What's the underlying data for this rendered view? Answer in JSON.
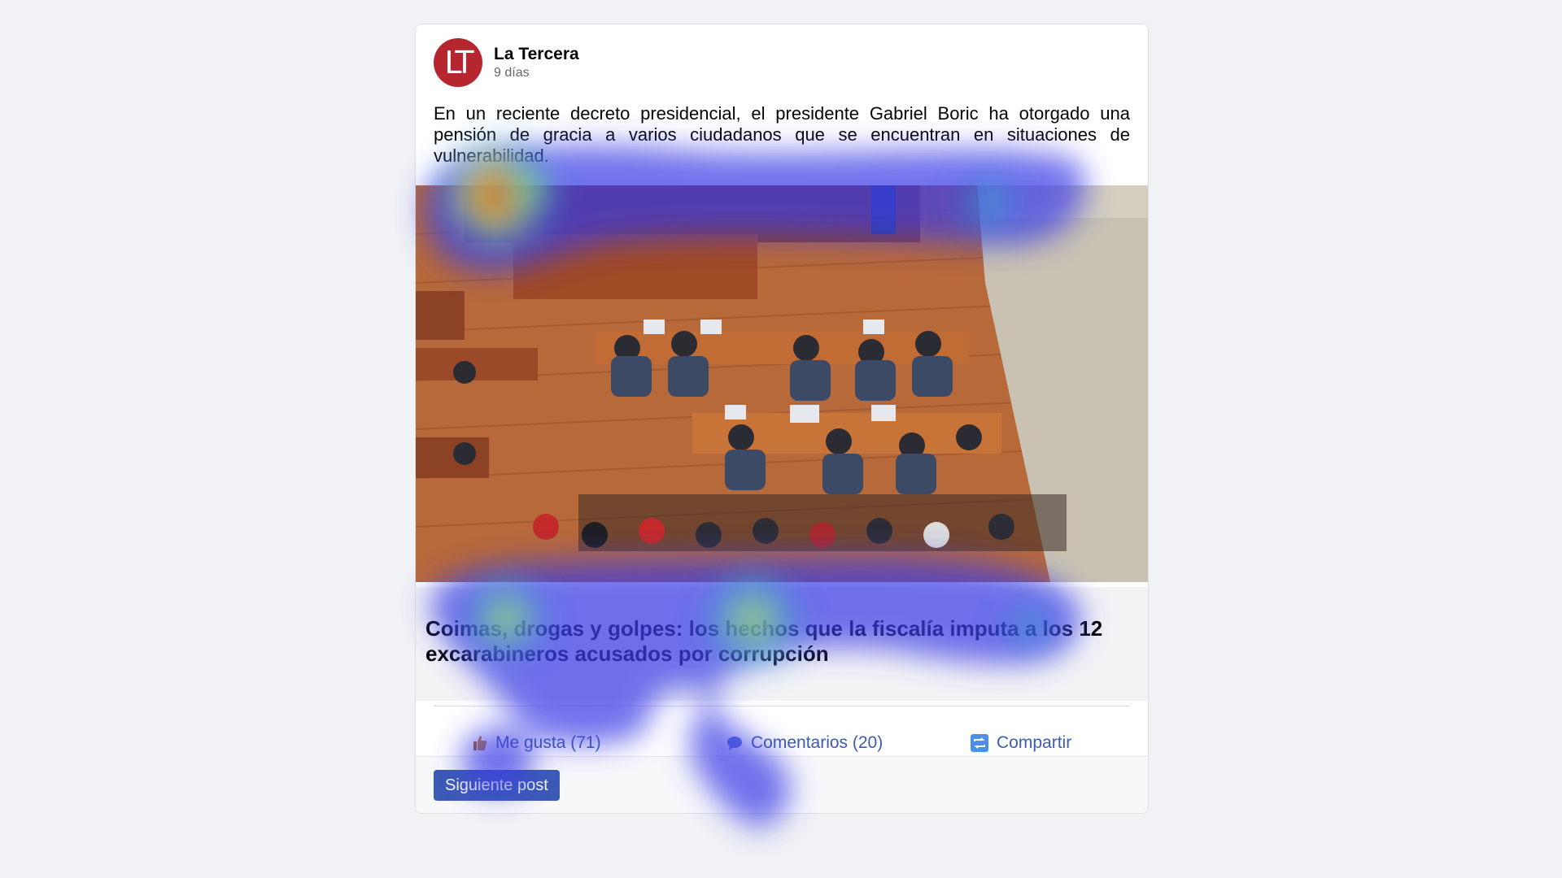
{
  "post": {
    "author": "La Tercera",
    "avatar_initials": "LT",
    "time": "9 días",
    "text": "En un reciente decreto presidencial, el presidente Gabriel Boric ha otorgado una pensión de gracia a varios ciudadanos que se encuentran en situaciones de vulnerabilidad.",
    "headline": "Coimas, drogas y golpes: los hechos que la fiscalía imputa a los 12 excarabineros acusados por corrupción",
    "image_icon": "courtroom-photo"
  },
  "actions": {
    "like": "Me gusta (71)",
    "comment": "Comentarios (20)",
    "share": "Compartir",
    "like_icon": "thumbs-up-icon",
    "comment_icon": "comment-icon",
    "share_icon": "share-icon"
  },
  "footer": {
    "next_label": "Siguiente post"
  },
  "colors": {
    "brand": "#b5262f",
    "action": "#3b5bb5",
    "page_bg": "#f0f2f5",
    "heat_low": "#3c3ce6",
    "heat_high": "#c81e1e"
  }
}
